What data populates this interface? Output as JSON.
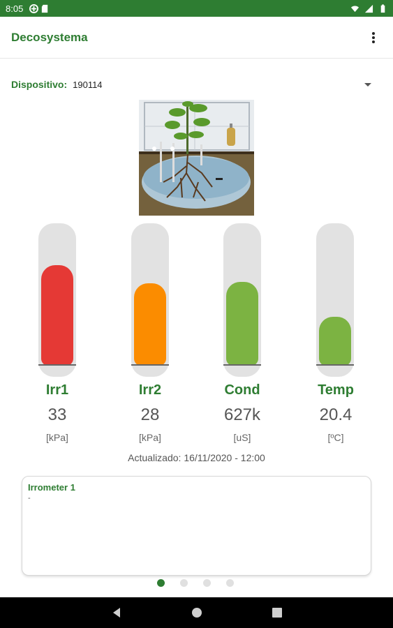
{
  "status_bar": {
    "time": "8:05",
    "left_icons": [
      "data-saver-icon",
      "sd-card-icon"
    ],
    "right_icons": [
      "wifi-icon",
      "signal-icon",
      "battery-icon"
    ]
  },
  "app_bar": {
    "title": "Decosystema",
    "menu_icon": "more-vert-icon"
  },
  "device": {
    "label": "Dispositivo:",
    "value": "190114"
  },
  "gauges": [
    {
      "name": "Irr1",
      "value": "33",
      "unit": "[kPa]",
      "color": "#e53935",
      "level": 0.72
    },
    {
      "name": "Irr2",
      "value": "28",
      "unit": "[kPa]",
      "color": "#fb8c00",
      "level": 0.59
    },
    {
      "name": "Cond",
      "value": "627k",
      "unit": "[uS]",
      "color": "#7cb342",
      "level": 0.6
    },
    {
      "name": "Temp",
      "value": "20.4",
      "unit": "[ºC]",
      "color": "#7cb342",
      "level": 0.35
    }
  ],
  "updated_text": "Actualizado: 16/11/2020 - 12:00",
  "card": {
    "title": "Irrometer 1",
    "body": "-"
  },
  "pager": {
    "count": 4,
    "active": 0
  },
  "colors": {
    "primary": "#2e7d32",
    "track": "#e2e2e2"
  },
  "nav_bar": [
    "back-icon",
    "home-icon",
    "recents-icon"
  ]
}
